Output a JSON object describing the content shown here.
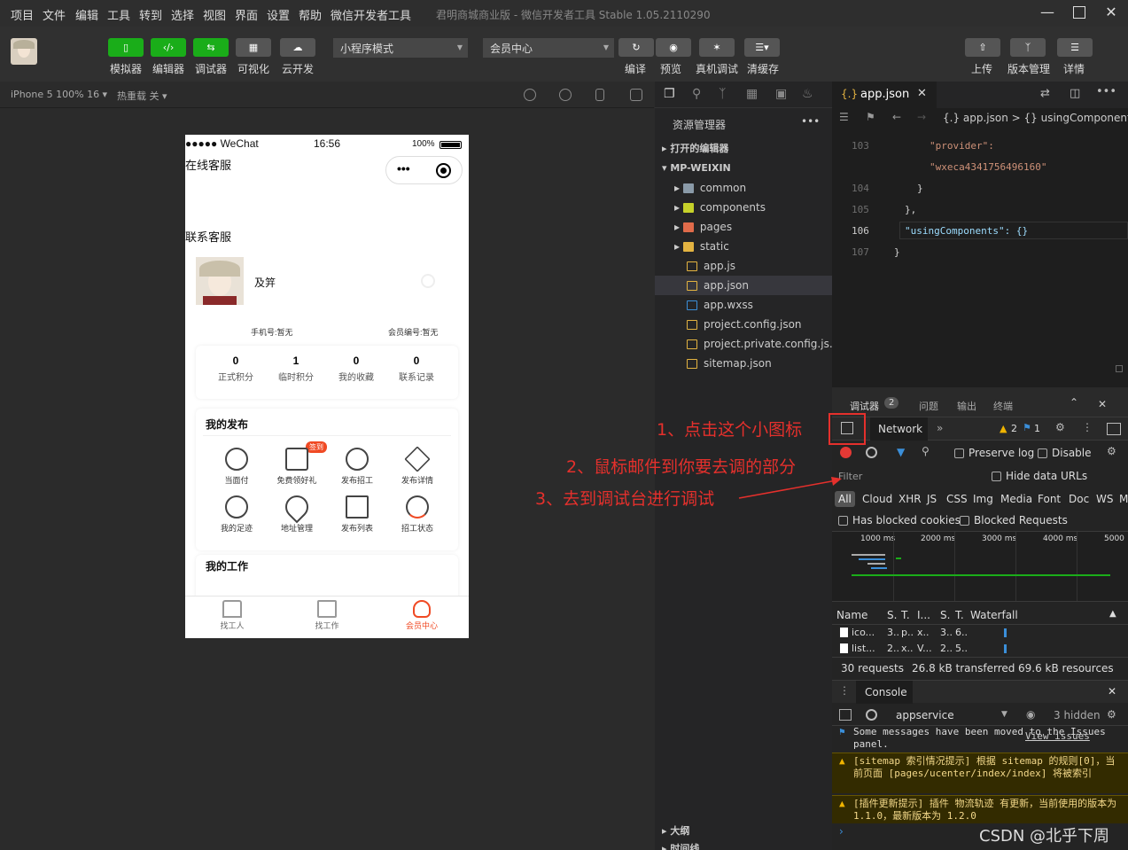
{
  "menu": [
    "项目",
    "文件",
    "编辑",
    "工具",
    "转到",
    "选择",
    "视图",
    "界面",
    "设置",
    "帮助",
    "微信开发者工具"
  ],
  "window_title": "君明商城商业版 - 微信开发者工具 Stable 1.05.2110290",
  "toolbar": {
    "left_buttons": [
      {
        "label": "模拟器",
        "style": "green"
      },
      {
        "label": "编辑器",
        "style": "green"
      },
      {
        "label": "调试器",
        "style": "green"
      },
      {
        "label": "可视化",
        "style": "gray"
      },
      {
        "label": "云开发",
        "style": "gray"
      }
    ],
    "mode_select": "小程序模式",
    "page_select": "会员中心",
    "mid_buttons": [
      "编译",
      "预览",
      "真机调试",
      "清缓存"
    ],
    "right_buttons": [
      "上传",
      "版本管理",
      "详情"
    ]
  },
  "simbar": {
    "device": "iPhone 5 100% 16 ▾",
    "hot_reload": "热重载 关 ▾"
  },
  "phone": {
    "status_carrier": "●●●●● WeChat",
    "status_time": "16:56",
    "status_battery": "100%",
    "top_label": "在线客服",
    "contact_label": "联系客服",
    "user_name": "及笄",
    "phone_label": "手机号:暂无",
    "member_label": "会员编号:暂无",
    "stats": [
      {
        "value": "0",
        "label": "正式积分"
      },
      {
        "value": "1",
        "label": "临时积分"
      },
      {
        "value": "0",
        "label": "我的收藏"
      },
      {
        "value": "0",
        "label": "联系记录"
      }
    ],
    "section1_title": "我的发布",
    "badge": "签到",
    "grid1": [
      "当面付",
      "免费领好礼",
      "发布招工",
      "发布详情"
    ],
    "grid2": [
      "我的足迹",
      "地址管理",
      "发布列表",
      "招工状态"
    ],
    "section2_title": "我的工作",
    "tabs": [
      {
        "label": "找工人",
        "active": false
      },
      {
        "label": "找工作",
        "active": false
      },
      {
        "label": "会员中心",
        "active": true
      }
    ]
  },
  "explorer": {
    "title": "资源管理器",
    "open_editors": "打开的编辑器",
    "project": "MP-WEIXIN",
    "items": [
      {
        "name": "common",
        "type": "folder",
        "color": "#8a9aa8"
      },
      {
        "name": "components",
        "type": "folder",
        "color": "#c6d12a"
      },
      {
        "name": "pages",
        "type": "folder",
        "color": "#e06b4a"
      },
      {
        "name": "static",
        "type": "folder",
        "color": "#e3b341"
      },
      {
        "name": "app.js",
        "type": "js",
        "color": "#e3b341"
      },
      {
        "name": "app.json",
        "type": "json",
        "color": "#e3b341",
        "selected": true
      },
      {
        "name": "app.wxss",
        "type": "css",
        "color": "#3b8fd9"
      },
      {
        "name": "project.config.json",
        "type": "json",
        "color": "#e3b341"
      },
      {
        "name": "project.private.config.js...",
        "type": "json",
        "color": "#e3b341"
      },
      {
        "name": "sitemap.json",
        "type": "json",
        "color": "#e3b341"
      }
    ],
    "outline": "大纲",
    "timeline": "时间线"
  },
  "editor": {
    "tab": "app.json",
    "breadcrumb": "{.} app.json > {} usingComponent",
    "lines": [
      {
        "n": "103",
        "text": "\"provider\":"
      },
      {
        "n": "",
        "text": "\"wxeca4341756496160\""
      },
      {
        "n": "104",
        "text": "}"
      },
      {
        "n": "105",
        "text": "},"
      },
      {
        "n": "106",
        "text": "\"usingComponents\": {}"
      },
      {
        "n": "107",
        "text": "}"
      }
    ]
  },
  "devtools": {
    "tabs": [
      {
        "label": "调试器",
        "count": "2"
      },
      {
        "label": "问题"
      },
      {
        "label": "输出"
      },
      {
        "label": "终端"
      }
    ],
    "panel": "Network",
    "warn_count": "2",
    "info_count": "1",
    "preserve_log": "Preserve log",
    "disable": "Disable",
    "filter": "Filter",
    "hide_data_urls": "Hide data URLs",
    "types": [
      "All",
      "Cloud",
      "XHR",
      "JS",
      "CSS",
      "Img",
      "Media",
      "Font",
      "Doc",
      "WS",
      "M"
    ],
    "has_blocked": "Has blocked cookies",
    "blocked_requests": "Blocked Requests",
    "timeline_ticks": [
      "1000 ms",
      "2000 ms",
      "3000 ms",
      "4000 ms",
      "5000"
    ],
    "columns": [
      "Name",
      "S.",
      "T.",
      "I...",
      "S.",
      "T.",
      "Waterfall"
    ],
    "rows": [
      {
        "name": "ico...",
        "c1": "3..",
        "c2": "p..",
        "c3": "x..",
        "c4": "3..",
        "c5": "6.."
      },
      {
        "name": "list...",
        "c1": "2..",
        "c2": "x..",
        "c3": "V...",
        "c4": "2..",
        "c5": "5.."
      }
    ],
    "summary": [
      "30 requests",
      "26.8 kB transferred",
      "69.6 kB resources"
    ],
    "console_tab": "Console",
    "context": "appservice",
    "hidden": "3 hidden",
    "messages": [
      {
        "type": "info",
        "text": "Some messages have been moved to the Issues panel.",
        "link": "View issues"
      },
      {
        "type": "warn",
        "text": "[sitemap 索引情况提示] 根据 sitemap 的规则[0]，当前页面 [pages/ucenter/index/index] 将被索引"
      },
      {
        "type": "warn",
        "text": "[插件更新提示] 插件 物流轨迹 有更新，当前使用的版本为 1.1.0，最新版本为 1.2.0"
      }
    ]
  },
  "annotations": [
    "1、点击这个小图标",
    "2、鼠标邮件到你要去调的部分",
    "3、去到调试台进行调试"
  ],
  "watermark": "CSDN @北乎下周"
}
